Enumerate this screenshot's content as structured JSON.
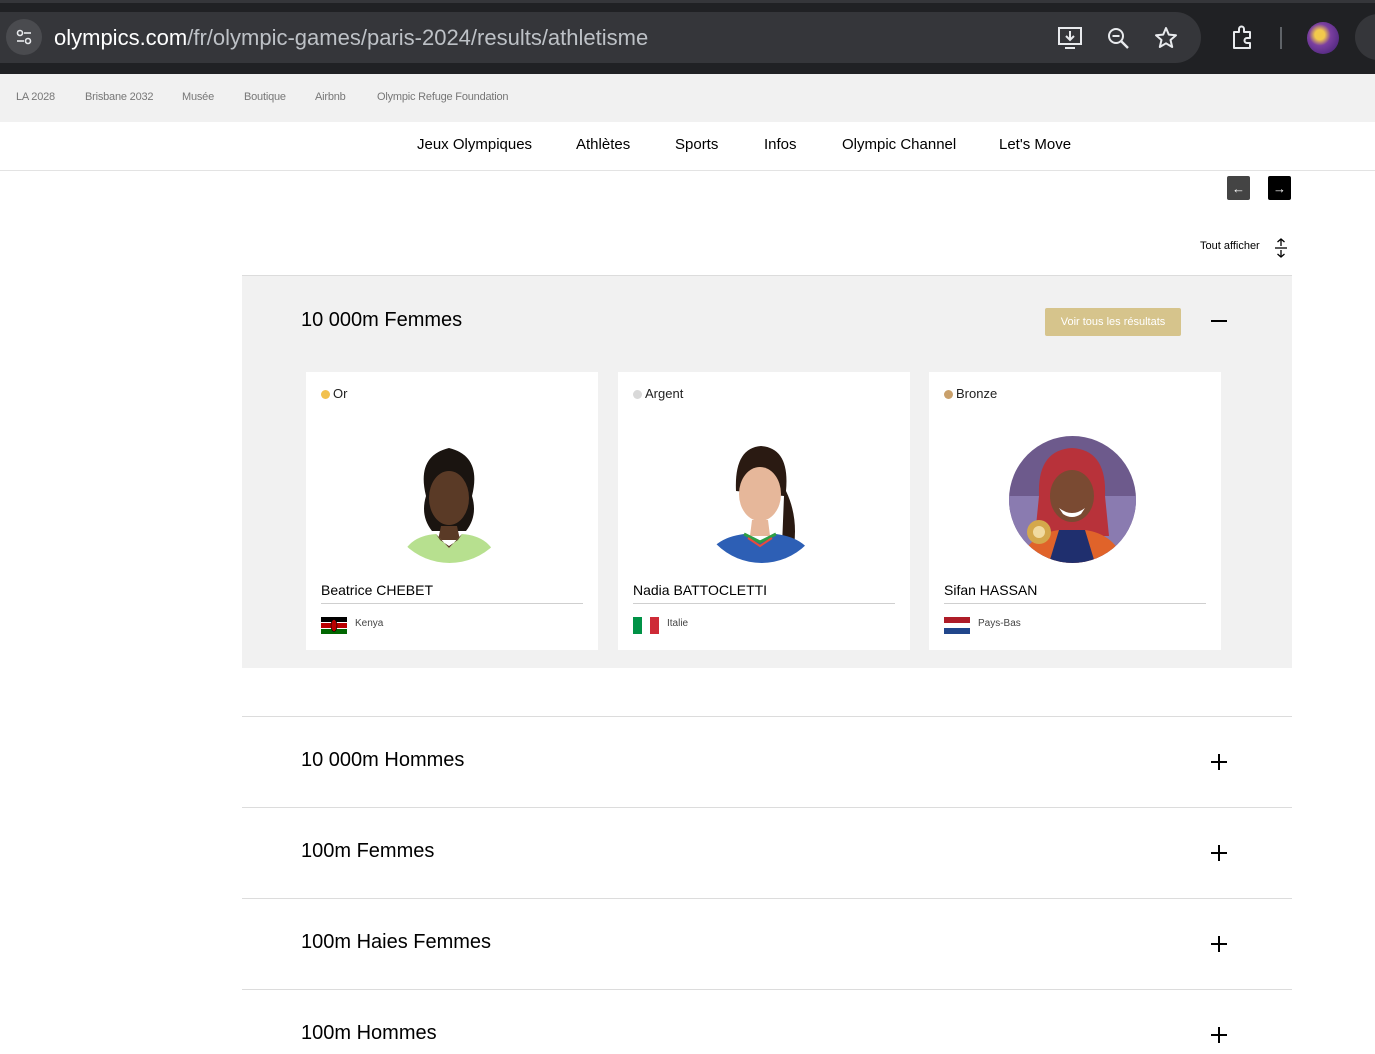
{
  "browser": {
    "url_host": "olympics.com",
    "url_path": "/fr/olympic-games/paris-2024/results/athletisme"
  },
  "utility_nav": [
    "LA 2028",
    "Brisbane 2032",
    "Musée",
    "Boutique",
    "Airbnb",
    "Olympic Refuge Foundation"
  ],
  "main_nav": [
    "Jeux Olympiques",
    "Athlètes",
    "Sports",
    "Infos",
    "Olympic Channel",
    "Let's Move"
  ],
  "controls": {
    "prev_arrow": "←",
    "next_arrow": "→",
    "show_all": "Tout afficher"
  },
  "open_event": {
    "title": "10 000m Femmes",
    "results_button": "Voir tous les résultats",
    "podium": [
      {
        "medal": "Or",
        "medal_color": "#f2c14e",
        "name": "Beatrice CHEBET",
        "country": "Kenya"
      },
      {
        "medal": "Argent",
        "medal_color": "#d9d9d9",
        "name": "Nadia BATTOCLETTI",
        "country": "Italie"
      },
      {
        "medal": "Bronze",
        "medal_color": "#c9a06b",
        "name": "Sifan HASSAN",
        "country": "Pays-Bas"
      }
    ]
  },
  "events": [
    "10 000m Hommes",
    "100m Femmes",
    "100m Haies Femmes",
    "100m Hommes"
  ],
  "colors": {
    "results_button": "#d6c48c",
    "accordion_bg": "#f1f1f1"
  }
}
